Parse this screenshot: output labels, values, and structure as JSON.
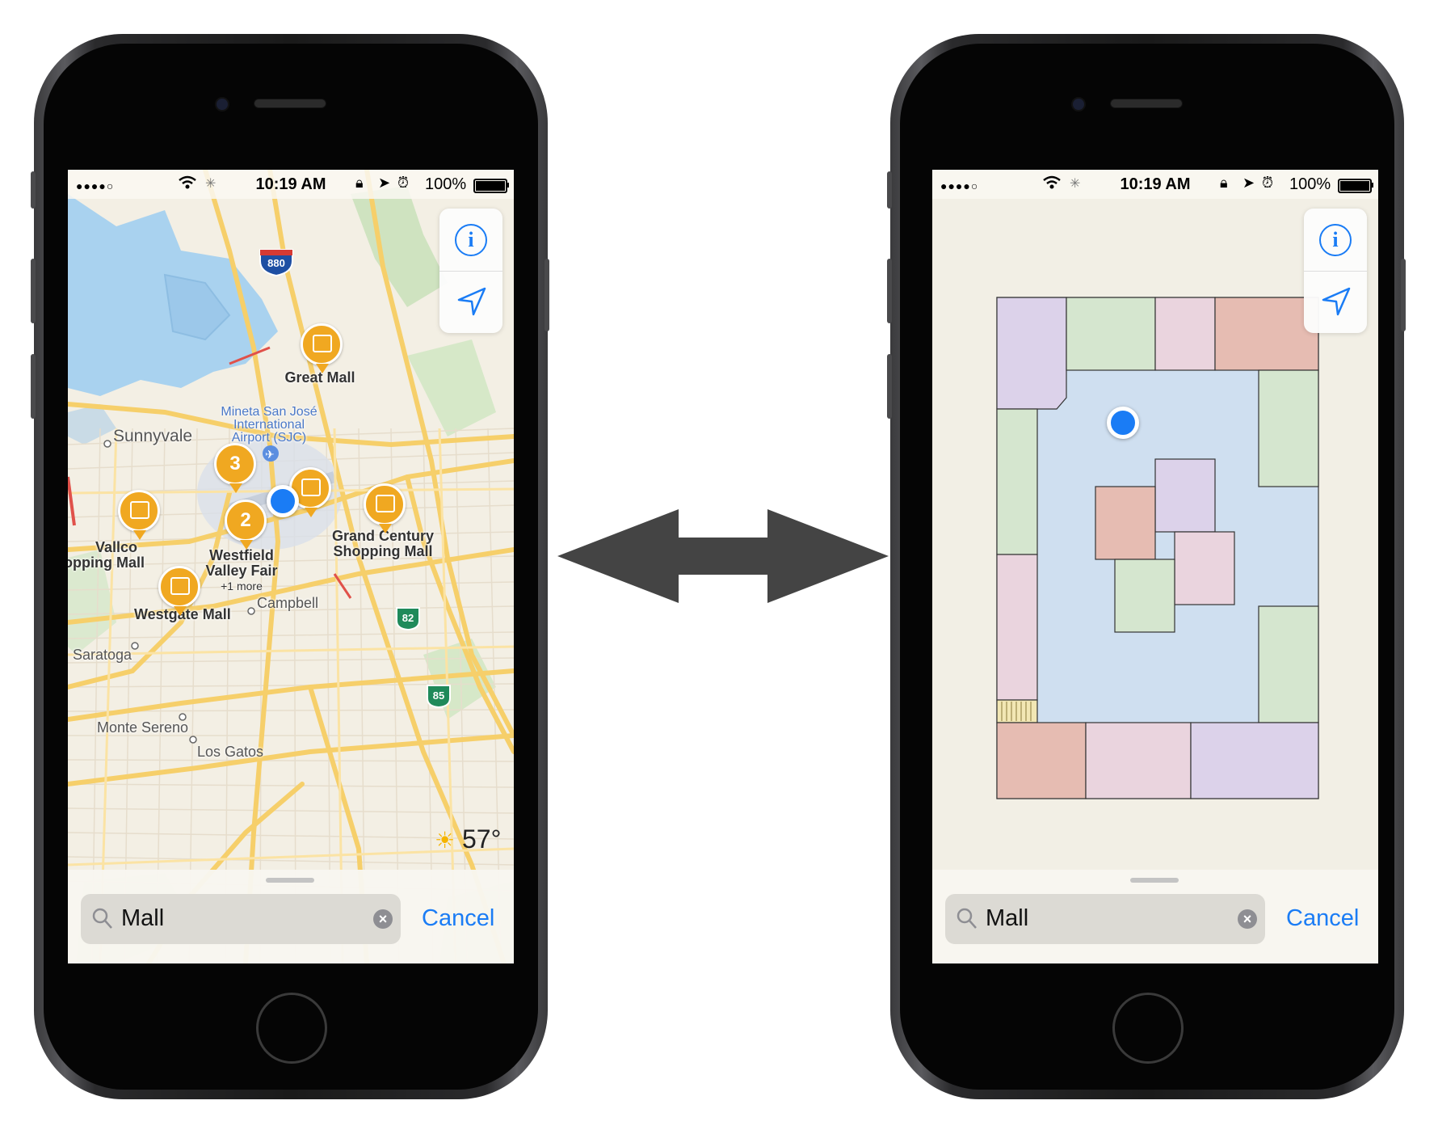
{
  "status_bar": {
    "signal": "●●●●○",
    "time": "10:19 AM",
    "battery": "100%"
  },
  "search": {
    "query": "Mall",
    "cancel_label": "Cancel"
  },
  "map_left": {
    "places": {
      "great_mall": "Great Mall",
      "airport": "Mineta San José International Airport (SJC)",
      "airport_line1": "Mineta San José",
      "airport_line2": "International",
      "airport_line3": "Airport (SJC)",
      "sunnyvale": "Sunnyvale",
      "vallco_line1": "Vallco",
      "vallco_line2": "opping Mall",
      "westfield_line1": "Westfield",
      "westfield_line2": "Valley Fair",
      "westfield_more": "+1 more",
      "grand_line1": "Grand Century",
      "grand_line2": "Shopping Mall",
      "westgate": "Westgate Mall",
      "campbell": "Campbell",
      "saratoga": "Saratoga",
      "monte_sereno": "Monte Sereno",
      "los_gatos": "Los Gatos"
    },
    "cluster_counts": [
      "3",
      "2"
    ],
    "highways": [
      "880",
      "82",
      "85"
    ],
    "temperature": "57°"
  },
  "colors": {
    "accent": "#1a7cf5",
    "pin": "#f0a821",
    "highway_interstate": "#1e4fa3",
    "highway_state": "#1f8a5a"
  }
}
